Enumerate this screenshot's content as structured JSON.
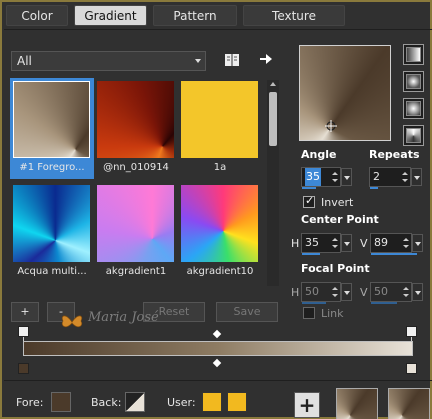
{
  "tabs": [
    {
      "label": "Color",
      "active": false
    },
    {
      "label": "Gradient",
      "active": true
    },
    {
      "label": "Pattern",
      "active": false
    },
    {
      "label": "Texture",
      "active": false
    }
  ],
  "category": {
    "selected": "All"
  },
  "gradients": [
    {
      "label": "#1 Foregro...",
      "selected": true
    },
    {
      "label": "@nn_010914",
      "selected": false
    },
    {
      "label": "1a",
      "selected": false
    },
    {
      "label": "Acqua multi...",
      "selected": false
    },
    {
      "label": "akgradient1",
      "selected": false
    },
    {
      "label": "akgradient10",
      "selected": false
    }
  ],
  "controls": {
    "angle_label": "Angle",
    "angle_value": "35",
    "repeats_label": "Repeats",
    "repeats_value": "2",
    "invert_label": "Invert",
    "invert_checked": true,
    "center_label": "Center Point",
    "center_h_label": "H",
    "center_h": "35",
    "center_v_label": "V",
    "center_v": "89",
    "focal_label": "Focal Point",
    "focal_h_label": "H",
    "focal_h": "50",
    "focal_v_label": "V",
    "focal_v": "50",
    "link_label": "Link",
    "link_checked": false
  },
  "buttons": {
    "add": "+",
    "remove": "-",
    "reset": "Reset",
    "save": "Save",
    "new": "+"
  },
  "watermark": "Maria José",
  "footer": {
    "fore_label": "Fore:",
    "back_label": "Back:",
    "user_label": "User:"
  },
  "colors": {
    "accent": "#3d88d6",
    "gradient_dark": "#4b3a2a",
    "gradient_light": "#e8e2d8",
    "user_swatch": "#f2b91f",
    "frame": "#8a7a3c"
  },
  "icons": {
    "presets": "book-icon",
    "import": "arrow-right-icon",
    "styles": [
      "linear-style-icon",
      "rectangular-style-icon",
      "sunburst-style-icon",
      "radial-style-icon"
    ]
  }
}
